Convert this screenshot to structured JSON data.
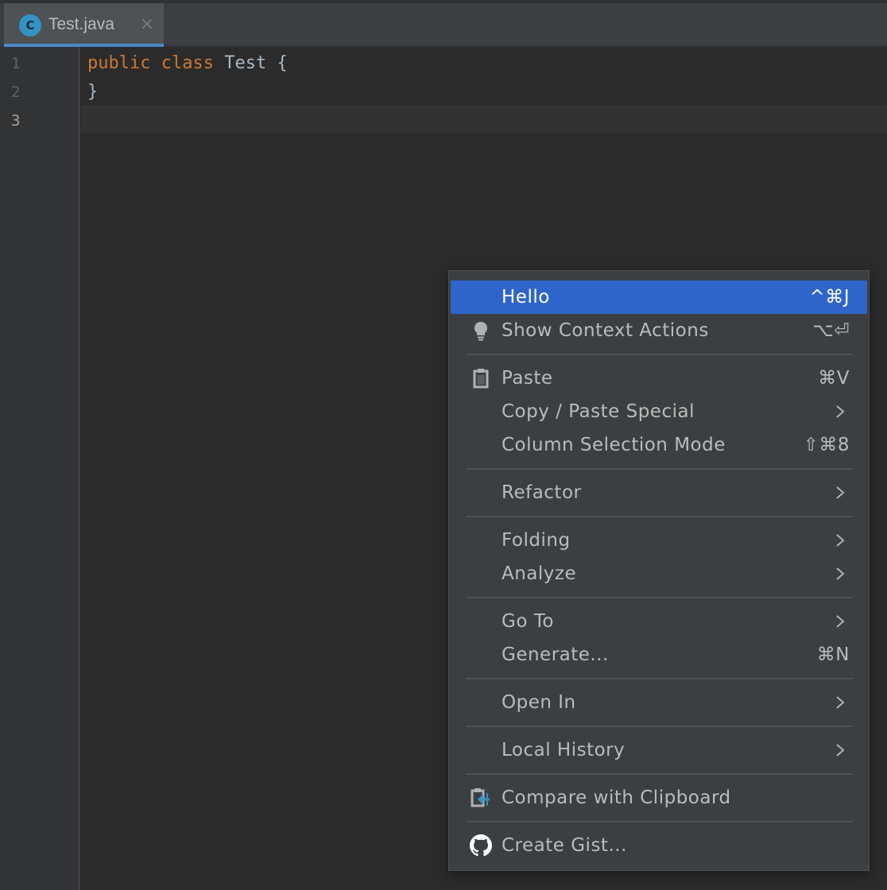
{
  "tab": {
    "icon_letter": "C",
    "label": "Test.java",
    "close_glyph": "×"
  },
  "gutter": {
    "lines": [
      "1",
      "2",
      "3"
    ]
  },
  "code": {
    "line1": {
      "kw1": "public",
      "kw2": "class",
      "name": "Test",
      "brace": "{"
    },
    "line2": "}"
  },
  "menu": {
    "items": [
      {
        "label": "Hello",
        "shortcut": "^⌘J",
        "selected": true
      },
      {
        "label": "Show Context Actions",
        "shortcut": "⌥⏎",
        "icon": "lightbulb-icon"
      },
      {
        "label": "Paste",
        "shortcut": "⌘V",
        "icon": "clipboard-icon"
      },
      {
        "label": "Copy / Paste Special",
        "submenu": true
      },
      {
        "label": "Column Selection Mode",
        "shortcut": "⇧⌘8"
      },
      {
        "label": "Refactor",
        "submenu": true
      },
      {
        "label": "Folding",
        "submenu": true
      },
      {
        "label": "Analyze",
        "submenu": true
      },
      {
        "label": "Go To",
        "submenu": true
      },
      {
        "label": "Generate...",
        "shortcut": "⌘N"
      },
      {
        "label": "Open In",
        "submenu": true
      },
      {
        "label": "Local History",
        "submenu": true
      },
      {
        "label": "Compare with Clipboard",
        "icon": "compare-clipboard-icon"
      },
      {
        "label": "Create Gist...",
        "icon": "github-icon"
      }
    ]
  },
  "colors": {
    "editor_bg": "#2b2b2b",
    "gutter_bg": "#313335",
    "menu_bg": "#3c3f41",
    "selection": "#2f65ca",
    "keyword": "#cc7832",
    "tab_accent": "#4a88c7"
  }
}
